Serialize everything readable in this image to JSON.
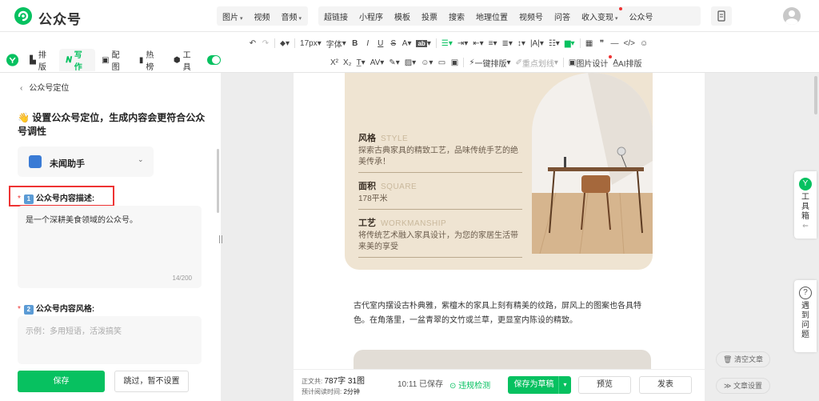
{
  "app": {
    "name": "公众号"
  },
  "topnav": {
    "group1": [
      "图片",
      "视频",
      "音频"
    ],
    "group2": [
      "超链接",
      "小程序",
      "模板",
      "投票",
      "搜索",
      "地理位置",
      "视频号",
      "问答",
      "收入变现",
      "公众号"
    ]
  },
  "toolbar": {
    "font_size": "17px",
    "font_label": "字体",
    "ai_layout": "一键排版",
    "key_line": "重点划线",
    "image_design": "图片设计",
    "ai_typeset": "AI排版"
  },
  "left_tabs": [
    "排版",
    "写作",
    "配图",
    "热榜",
    "工具"
  ],
  "panel": {
    "back_label": "公众号定位",
    "heading": "设置公众号定位，生成内容会更符合公众号调性",
    "assistant": "未闻助手",
    "field1": {
      "num": "1",
      "label": "公众号内容描述:",
      "value": "是一个深耕美食领域的公众号。",
      "count": "14/200"
    },
    "field2": {
      "num": "2",
      "label": "公众号内容风格:",
      "placeholder": "示例：多用短语，活泼搞笑"
    },
    "save": "保存",
    "skip": "跳过，暂不设置"
  },
  "article": {
    "specs": [
      {
        "title": "风格",
        "en": "STYLE",
        "desc": "探索古典家具的精致工艺，品味传统手艺的绝美传承！"
      },
      {
        "title": "面积",
        "en": "SQUARE",
        "desc": "178平米"
      },
      {
        "title": "工艺",
        "en": "WORKMANSHIP",
        "desc": "将传统艺术融入家具设计，为您的家居生活带来美的享受"
      }
    ],
    "paragraph": "古代室内摆设古朴典雅，紫檀木的家具上刻有精美的纹路，屏风上的图案也各具特色。在角落里，一盆青翠的文竹或兰草，更显室内陈设的精致。"
  },
  "footer": {
    "body_label": "正文共:",
    "body_count": "787字 31图",
    "read_label": "预计阅读时间:",
    "read_time": "2分钟",
    "saved": "10:11 已保存",
    "check": "违规检测",
    "draft": "保存为草稿",
    "preview": "预览",
    "publish": "发表"
  },
  "side": {
    "toolbox": "工具箱",
    "question": "遇到问题",
    "clear": "清空文章",
    "settings": "文章设置"
  },
  "colors": {
    "brand": "#07c160",
    "highlight": "#e33333",
    "card_bg": "#efe4d2"
  }
}
